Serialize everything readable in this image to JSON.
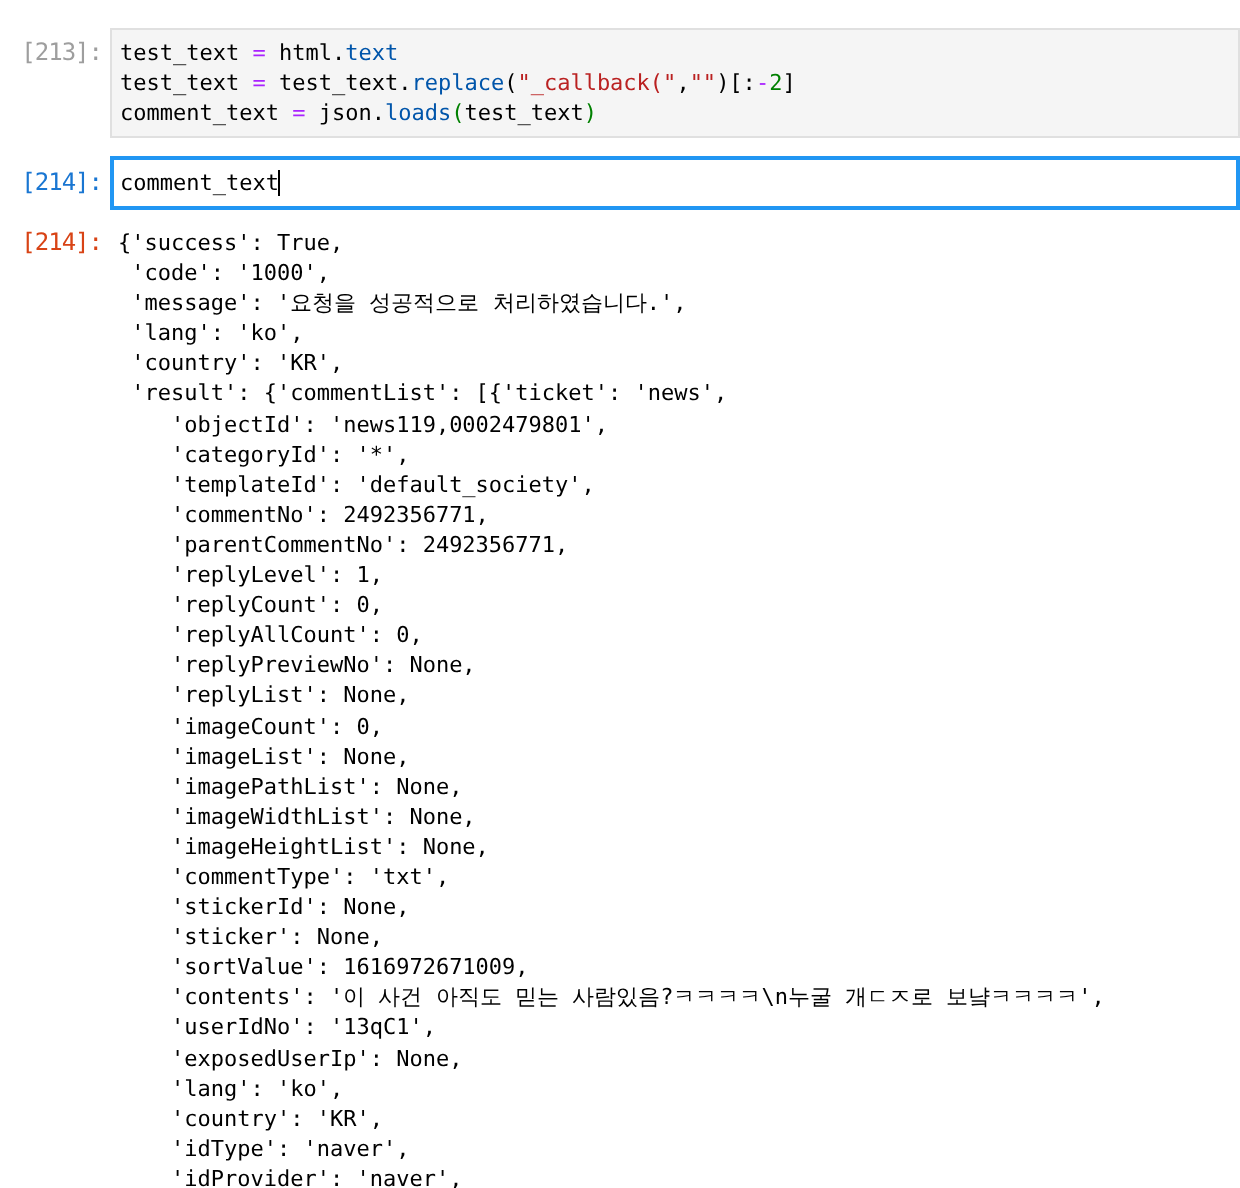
{
  "cells": [
    {
      "kind": "code",
      "prompt": "[213]:",
      "selected": false,
      "editing": false,
      "lines": [
        [
          {
            "t": "test_text ",
            "kind": "plain"
          },
          {
            "t": "=",
            "kind": "op"
          },
          {
            "t": " html.",
            "kind": "plain"
          },
          {
            "t": "text",
            "kind": "attr"
          }
        ],
        [
          {
            "t": "test_text ",
            "kind": "plain"
          },
          {
            "t": "=",
            "kind": "op"
          },
          {
            "t": " test_text.",
            "kind": "plain"
          },
          {
            "t": "replace",
            "kind": "attr"
          },
          {
            "t": "(",
            "kind": "plain"
          },
          {
            "t": "\"_callback(\"",
            "kind": "string"
          },
          {
            "t": ",",
            "kind": "plain"
          },
          {
            "t": "\"\"",
            "kind": "string"
          },
          {
            "t": ")[:",
            "kind": "plain"
          },
          {
            "t": "-",
            "kind": "op"
          },
          {
            "t": "2",
            "kind": "number"
          },
          {
            "t": "]",
            "kind": "plain"
          }
        ],
        [
          {
            "t": "comment_text ",
            "kind": "plain"
          },
          {
            "t": "=",
            "kind": "op"
          },
          {
            "t": " json.",
            "kind": "plain"
          },
          {
            "t": "loads",
            "kind": "attr"
          },
          {
            "t": "(",
            "kind": "bracket"
          },
          {
            "t": "test_text",
            "kind": "plain"
          },
          {
            "t": ")",
            "kind": "bracket"
          }
        ]
      ]
    },
    {
      "kind": "code",
      "prompt": "[214]:",
      "selected": true,
      "editing": true,
      "lines": [
        [
          {
            "t": "comment_text",
            "kind": "plain"
          }
        ]
      ]
    },
    {
      "kind": "output",
      "prompt": "[214]:",
      "text_lines": [
        "{'success': True,",
        " 'code': '1000',",
        " 'message': '요청을 성공적으로 처리하였습니다.',",
        " 'lang': 'ko',",
        " 'country': 'KR',",
        " 'result': {'commentList': [{'ticket': 'news',",
        "    'objectId': 'news119,0002479801',",
        "    'categoryId': '*',",
        "    'templateId': 'default_society',",
        "    'commentNo': 2492356771,",
        "    'parentCommentNo': 2492356771,",
        "    'replyLevel': 1,",
        "    'replyCount': 0,",
        "    'replyAllCount': 0,",
        "    'replyPreviewNo': None,",
        "    'replyList': None,",
        "    'imageCount': 0,",
        "    'imageList': None,",
        "    'imagePathList': None,",
        "    'imageWidthList': None,",
        "    'imageHeightList': None,",
        "    'commentType': 'txt',",
        "    'stickerId': None,",
        "    'sticker': None,",
        "    'sortValue': 1616972671009,",
        "    'contents': '이 사건 아직도 믿는 사람있음?ㅋㅋㅋㅋ\\n누굴 개ㄷㅈ로 보냨ㅋㅋㅋㅋ',",
        "    'userIdNo': '13qC1',",
        "    'exposedUserIp': None,",
        "    'lang': 'ko',",
        "    'country': 'KR',",
        "    'idType': 'naver',",
        "    'idProvider': 'naver',"
      ]
    }
  ]
}
